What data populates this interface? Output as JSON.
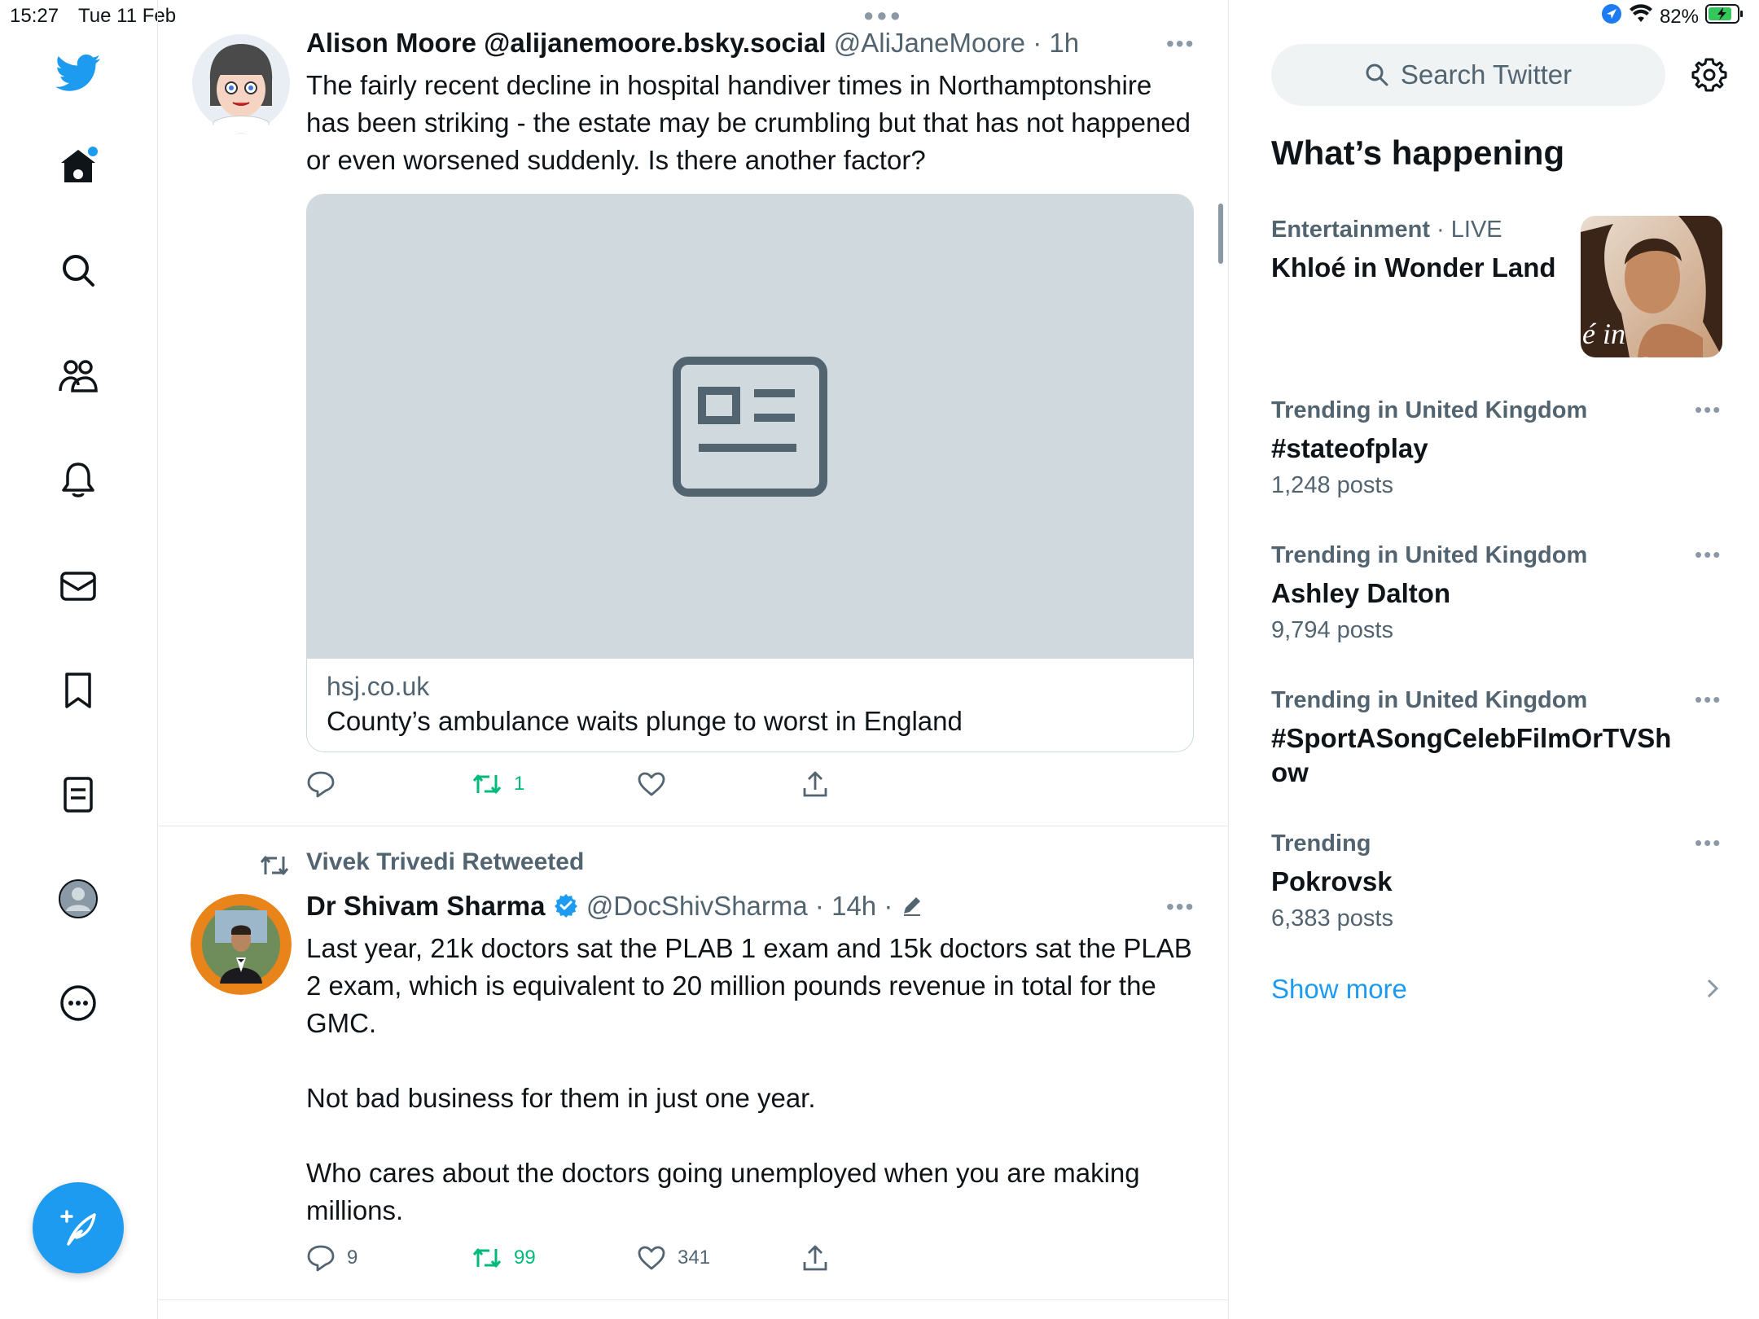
{
  "status_bar": {
    "time": "15:27",
    "date": "Tue 11 Feb",
    "battery": "82%"
  },
  "nav": {
    "items": [
      "twitter-logo",
      "home",
      "explore",
      "communities",
      "notifications",
      "messages",
      "bookmarks",
      "lists",
      "profile",
      "more"
    ],
    "compose_label": "Compose tweet"
  },
  "timeline": {
    "tweets": [
      {
        "name": "Alison Moore @alijanemoore.bsky.social",
        "handle": "@AliJaneMoore",
        "time": "1h",
        "text": "The fairly recent decline in hospital handiver times in Northamptonshire has been striking - the estate may be crumbling but that has not happened or even worsened suddenly. Is there another factor?",
        "card": {
          "domain": "hsj.co.uk",
          "title": "County’s ambulance waits plunge to worst in England"
        },
        "counts": {
          "replies": "",
          "retweets": "1",
          "likes": ""
        }
      },
      {
        "retweeted_by": "Vivek Trivedi Retweeted",
        "name": "Dr Shivam Sharma",
        "handle": "@DocShivSharma",
        "time": "14h",
        "text": "Last year, 21k doctors sat the PLAB 1 exam and 15k doctors sat the PLAB 2 exam, which is equivalent to 20 million pounds revenue in total for the GMC.\n\nNot bad business for them in just one year.\n\nWho cares about the doctors going unemployed when you are making millions.",
        "counts": {
          "replies": "9",
          "retweets": "99",
          "likes": "341"
        }
      }
    ]
  },
  "sidebar": {
    "search_placeholder": "Search Twitter",
    "whats_happening": "What’s happening",
    "trends": [
      {
        "category": "Entertainment",
        "live": "LIVE",
        "name": "Khloé in Wonder Land",
        "thumb_text": "é in Wonder l"
      },
      {
        "category": "Trending in United Kingdom",
        "name": "#stateofplay",
        "count": "1,248 posts"
      },
      {
        "category": "Trending in United Kingdom",
        "name": "Ashley Dalton",
        "count": "9,794 posts"
      },
      {
        "category": "Trending in United Kingdom",
        "name": "#SportASongCelebFilmOrTVShow",
        "count": ""
      },
      {
        "category": "Trending",
        "name": "Pokrovsk",
        "count": "6,383 posts"
      }
    ],
    "show_more": "Show more"
  },
  "colors": {
    "brand": "#1d9bf0",
    "retweet": "#00ba7c",
    "muted": "#536471"
  }
}
